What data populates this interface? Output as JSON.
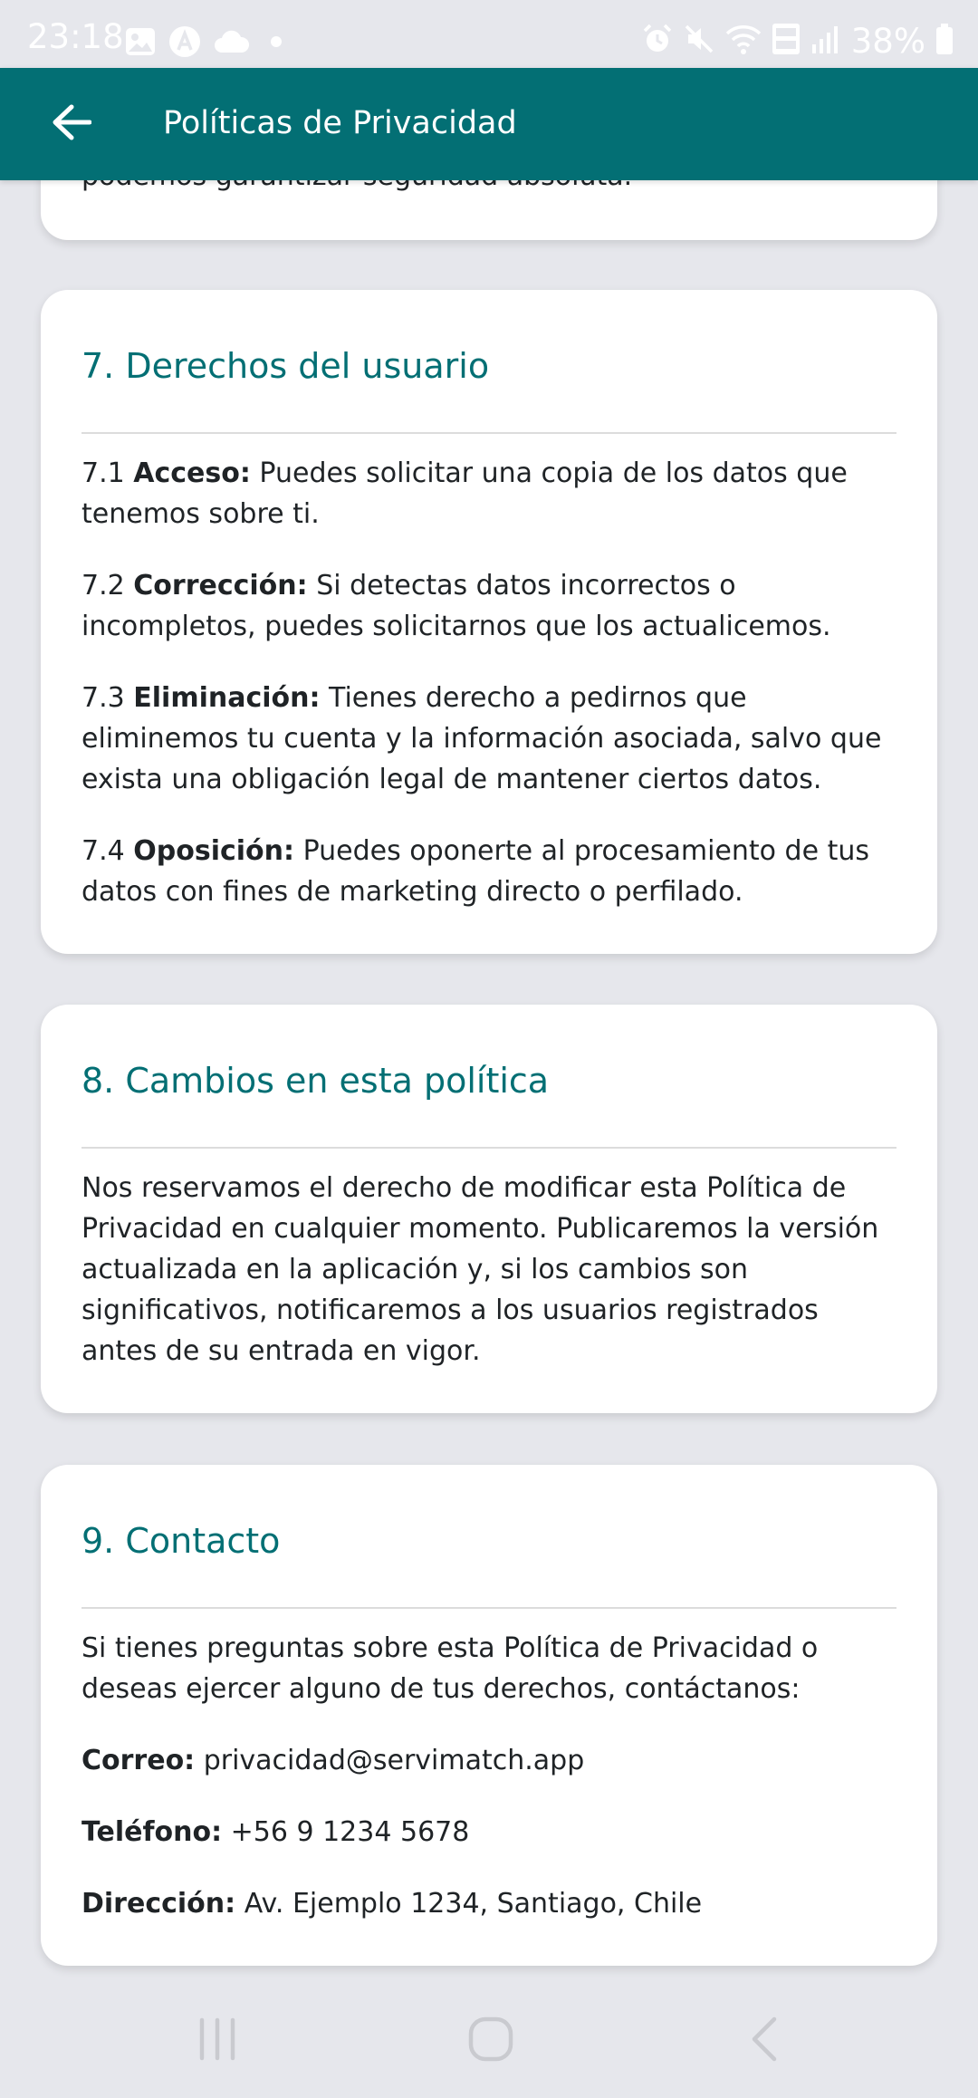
{
  "status_bar": {
    "time": "23:18",
    "battery": "38%",
    "icons_left": [
      "gallery-icon",
      "app-icon",
      "cloud-icon",
      "dot-icon"
    ],
    "icons_right": [
      "alarm-icon",
      "mute-icon",
      "wifi-icon",
      "volte-icon",
      "signal-icon",
      "battery-icon"
    ]
  },
  "app_bar": {
    "title": "Políticas de Privacidad",
    "back_icon": "arrow-left-icon"
  },
  "previous_card": {
    "tail_text": "podemos garantizar seguridad absoluta."
  },
  "sections": [
    {
      "title": "7. Derechos del usuario",
      "items": [
        {
          "num": "7.1",
          "label": "Acceso:",
          "text": " Puedes solicitar una copia de los datos que tenemos sobre ti."
        },
        {
          "num": "7.2",
          "label": "Corrección:",
          "text": " Si detectas datos incorrectos o incompletos, puedes solicitarnos que los actualicemos."
        },
        {
          "num": "7.3",
          "label": "Eliminación:",
          "text": " Tienes derecho a pedirnos que eliminemos tu cuenta y la información asociada, salvo que exista una obligación legal de mantener ciertos datos."
        },
        {
          "num": "7.4",
          "label": "Oposición:",
          "text": " Puedes oponerte al procesamiento de tus datos con fines de marketing directo o perfilado."
        }
      ]
    },
    {
      "title": "8. Cambios en esta política",
      "body": "Nos reservamos el derecho de modificar esta Política de Privacidad en cualquier momento. Publicaremos la versión actualizada en la aplicación y, si los cambios son significativos, notificaremos a los usuarios registrados antes de su entrada en vigor."
    },
    {
      "title": "9. Contacto",
      "intro": "Si tienes preguntas sobre esta Política de Privacidad o deseas ejercer alguno de tus derechos, contáctanos:",
      "contacts": [
        {
          "label": "Correo:",
          "value": " privacidad@servimatch.app"
        },
        {
          "label": "Teléfono:",
          "value": " +56 9 1234 5678"
        },
        {
          "label": "Dirección:",
          "value": " Av. Ejemplo 1234, Santiago, Chile"
        }
      ]
    }
  ],
  "nav_bar": {
    "items": [
      "recents-icon",
      "home-icon",
      "back-icon"
    ]
  },
  "colors": {
    "app_bar": "#036f74",
    "heading": "#036f74",
    "background": "#e6e7ec",
    "card": "#ffffff"
  }
}
